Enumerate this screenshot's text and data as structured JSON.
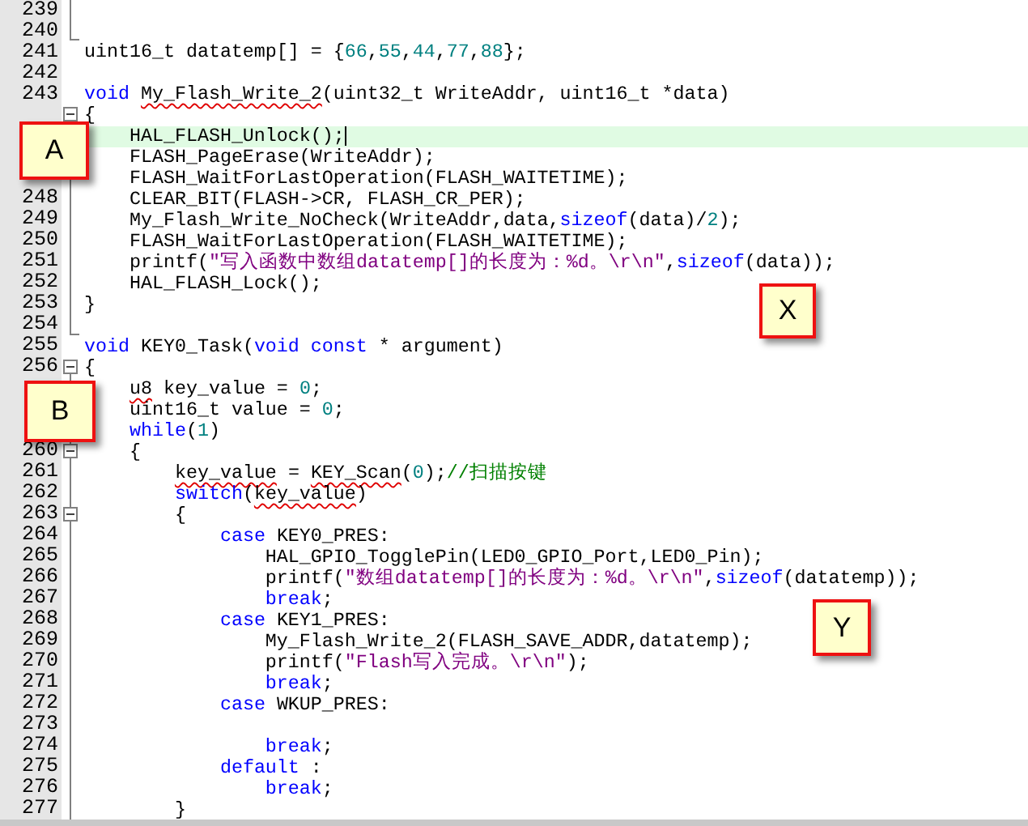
{
  "editor": {
    "lines": [
      {
        "number": "239",
        "fold": {
          "kind": "line"
        }
      },
      {
        "number": "240",
        "fold": {
          "kind": "end"
        }
      },
      {
        "number": "241",
        "tokens": [
          {
            "t": "uint16_t datatemp[] = {",
            "kind": "plain"
          },
          {
            "t": "66",
            "kind": "number"
          },
          {
            "t": ",",
            "kind": "plain"
          },
          {
            "t": "55",
            "kind": "number"
          },
          {
            "t": ",",
            "kind": "plain"
          },
          {
            "t": "44",
            "kind": "number"
          },
          {
            "t": ",",
            "kind": "plain"
          },
          {
            "t": "77",
            "kind": "number"
          },
          {
            "t": ",",
            "kind": "plain"
          },
          {
            "t": "88",
            "kind": "number"
          },
          {
            "t": "};",
            "kind": "plain"
          }
        ]
      },
      {
        "number": "242"
      },
      {
        "number": "243",
        "tokens": [
          {
            "t": "void",
            "kind": "keyword"
          },
          {
            "t": " My_Flash_Write_2",
            "kind": "plain",
            "squiggle": true
          },
          {
            "t": "(uint32_t WriteAddr, uint16_t *data)",
            "kind": "plain"
          }
        ]
      },
      {
        "fold": {
          "kind": "open"
        },
        "tokens": [
          {
            "t": "{",
            "kind": "plain"
          }
        ]
      },
      {
        "fold": {
          "kind": "line"
        },
        "current": true,
        "caret": true,
        "tokens": [
          {
            "t": "    HAL_FLASH_Unlock();",
            "kind": "plain"
          }
        ]
      },
      {
        "fold": {
          "kind": "line"
        },
        "tokens": [
          {
            "t": "    FLASH_PageErase(WriteAddr);",
            "kind": "plain"
          }
        ]
      },
      {
        "fold": {
          "kind": "line"
        },
        "tokens": [
          {
            "t": "    FLASH_WaitForLastOperation(FLASH_WAITETIME);",
            "kind": "plain"
          }
        ]
      },
      {
        "number": "248",
        "fold": {
          "kind": "line"
        },
        "tokens": [
          {
            "t": "    CLEAR_BIT(FLASH->CR, FLASH_CR_PER);",
            "kind": "plain"
          }
        ]
      },
      {
        "number": "249",
        "fold": {
          "kind": "line"
        },
        "tokens": [
          {
            "t": "    My_Flash_Write_NoCheck(WriteAddr,data,",
            "kind": "plain"
          },
          {
            "t": "sizeof",
            "kind": "keyword"
          },
          {
            "t": "(data)/",
            "kind": "plain"
          },
          {
            "t": "2",
            "kind": "number"
          },
          {
            "t": ");",
            "kind": "plain"
          }
        ]
      },
      {
        "number": "250",
        "fold": {
          "kind": "line"
        },
        "tokens": [
          {
            "t": "    FLASH_WaitForLastOperation(FLASH_WAITETIME);",
            "kind": "plain"
          }
        ]
      },
      {
        "number": "251",
        "fold": {
          "kind": "line"
        },
        "tokens": [
          {
            "t": "    printf(",
            "kind": "plain"
          },
          {
            "t": "\"写入函数中数组datatemp[]的长度为：%d。\\r\\n\"",
            "kind": "string"
          },
          {
            "t": ",",
            "kind": "plain"
          },
          {
            "t": "sizeof",
            "kind": "keyword"
          },
          {
            "t": "(data));",
            "kind": "plain"
          }
        ]
      },
      {
        "number": "252",
        "fold": {
          "kind": "line"
        },
        "tokens": [
          {
            "t": "    HAL_FLASH_Lock();",
            "kind": "plain"
          }
        ]
      },
      {
        "number": "253",
        "fold": {
          "kind": "line"
        },
        "tokens": [
          {
            "t": "}",
            "kind": "plain"
          }
        ]
      },
      {
        "number": "254",
        "fold": {
          "kind": "end"
        }
      },
      {
        "number": "255",
        "tokens": [
          {
            "t": "void",
            "kind": "keyword"
          },
          {
            "t": " KEY0_Task(",
            "kind": "plain"
          },
          {
            "t": "void",
            "kind": "keyword"
          },
          {
            "t": " const",
            "kind": "keyword"
          },
          {
            "t": " * argument)",
            "kind": "plain"
          }
        ]
      },
      {
        "number": "256",
        "fold": {
          "kind": "open"
        },
        "tokens": [
          {
            "t": "{",
            "kind": "plain"
          }
        ]
      },
      {
        "fold": {
          "kind": "line"
        },
        "tokens": [
          {
            "t": "    u8",
            "kind": "plain",
            "squiggle": true
          },
          {
            "t": " key_value = ",
            "kind": "plain"
          },
          {
            "t": "0",
            "kind": "number"
          },
          {
            "t": ";",
            "kind": "plain"
          }
        ]
      },
      {
        "fold": {
          "kind": "line"
        },
        "tokens": [
          {
            "t": "    uint16_t value = ",
            "kind": "plain"
          },
          {
            "t": "0",
            "kind": "number"
          },
          {
            "t": ";",
            "kind": "plain"
          }
        ]
      },
      {
        "fold": {
          "kind": "line"
        },
        "tokens": [
          {
            "t": "    while",
            "kind": "keyword"
          },
          {
            "t": "(",
            "kind": "plain"
          },
          {
            "t": "1",
            "kind": "number"
          },
          {
            "t": ")",
            "kind": "plain"
          }
        ]
      },
      {
        "number": "260",
        "fold": {
          "kind": "nested"
        },
        "tokens": [
          {
            "t": "    {",
            "kind": "plain"
          }
        ]
      },
      {
        "number": "261",
        "fold": {
          "kind": "line"
        },
        "tokens": [
          {
            "t": "        key_value",
            "kind": "plain",
            "squiggle": true
          },
          {
            "t": " = ",
            "kind": "plain"
          },
          {
            "t": "KEY_Scan",
            "kind": "plain",
            "squiggle": true
          },
          {
            "t": "(",
            "kind": "plain"
          },
          {
            "t": "0",
            "kind": "number"
          },
          {
            "t": ");",
            "kind": "plain"
          },
          {
            "t": "//扫描按键",
            "kind": "comment"
          }
        ]
      },
      {
        "number": "262",
        "fold": {
          "kind": "line"
        },
        "tokens": [
          {
            "t": "        switch",
            "kind": "keyword"
          },
          {
            "t": "(",
            "kind": "plain"
          },
          {
            "t": "key_value",
            "kind": "plain",
            "squiggle": true
          },
          {
            "t": ")",
            "kind": "plain"
          }
        ]
      },
      {
        "number": "263",
        "fold": {
          "kind": "nested"
        },
        "tokens": [
          {
            "t": "        {",
            "kind": "plain"
          }
        ]
      },
      {
        "number": "264",
        "fold": {
          "kind": "line"
        },
        "tokens": [
          {
            "t": "            case",
            "kind": "keyword"
          },
          {
            "t": " KEY0_PRES:",
            "kind": "plain"
          }
        ]
      },
      {
        "number": "265",
        "fold": {
          "kind": "line"
        },
        "tokens": [
          {
            "t": "                HAL_GPIO_TogglePin(LED0_GPIO_Port,LED0_Pin);",
            "kind": "plain"
          }
        ]
      },
      {
        "number": "266",
        "fold": {
          "kind": "line"
        },
        "tokens": [
          {
            "t": "                printf(",
            "kind": "plain"
          },
          {
            "t": "\"数组datatemp[]的长度为：%d。\\r\\n\"",
            "kind": "string"
          },
          {
            "t": ",",
            "kind": "plain"
          },
          {
            "t": "sizeof",
            "kind": "keyword"
          },
          {
            "t": "(datatemp));",
            "kind": "plain"
          }
        ]
      },
      {
        "number": "267",
        "fold": {
          "kind": "line"
        },
        "tokens": [
          {
            "t": "                break",
            "kind": "keyword"
          },
          {
            "t": ";",
            "kind": "plain"
          }
        ]
      },
      {
        "number": "268",
        "fold": {
          "kind": "line"
        },
        "tokens": [
          {
            "t": "            case",
            "kind": "keyword"
          },
          {
            "t": " KEY1_PRES:",
            "kind": "plain"
          }
        ]
      },
      {
        "number": "269",
        "fold": {
          "kind": "line"
        },
        "tokens": [
          {
            "t": "                My_Flash_Write_2(FLASH_SAVE_ADDR,datatemp);",
            "kind": "plain"
          }
        ]
      },
      {
        "number": "270",
        "fold": {
          "kind": "line"
        },
        "tokens": [
          {
            "t": "                printf(",
            "kind": "plain"
          },
          {
            "t": "\"Flash写入完成。\\r\\n\"",
            "kind": "string"
          },
          {
            "t": ");",
            "kind": "plain"
          }
        ]
      },
      {
        "number": "271",
        "fold": {
          "kind": "line"
        },
        "tokens": [
          {
            "t": "                break",
            "kind": "keyword"
          },
          {
            "t": ";",
            "kind": "plain"
          }
        ]
      },
      {
        "number": "272",
        "fold": {
          "kind": "line"
        },
        "tokens": [
          {
            "t": "            case",
            "kind": "keyword"
          },
          {
            "t": " WKUP_PRES:",
            "kind": "plain"
          }
        ]
      },
      {
        "number": "273",
        "fold": {
          "kind": "line"
        }
      },
      {
        "number": "274",
        "fold": {
          "kind": "line"
        },
        "tokens": [
          {
            "t": "                break",
            "kind": "keyword"
          },
          {
            "t": ";",
            "kind": "plain"
          }
        ]
      },
      {
        "number": "275",
        "fold": {
          "kind": "line"
        },
        "tokens": [
          {
            "t": "            default",
            "kind": "keyword"
          },
          {
            "t": " :",
            "kind": "plain"
          }
        ]
      },
      {
        "number": "276",
        "fold": {
          "kind": "line"
        },
        "tokens": [
          {
            "t": "                break",
            "kind": "keyword"
          },
          {
            "t": ";",
            "kind": "plain"
          }
        ]
      },
      {
        "number": "277",
        "fold": {
          "kind": "line"
        },
        "tokens": [
          {
            "t": "        }",
            "kind": "plain"
          }
        ]
      }
    ]
  },
  "callouts": [
    "A",
    "B",
    "X",
    "Y"
  ]
}
